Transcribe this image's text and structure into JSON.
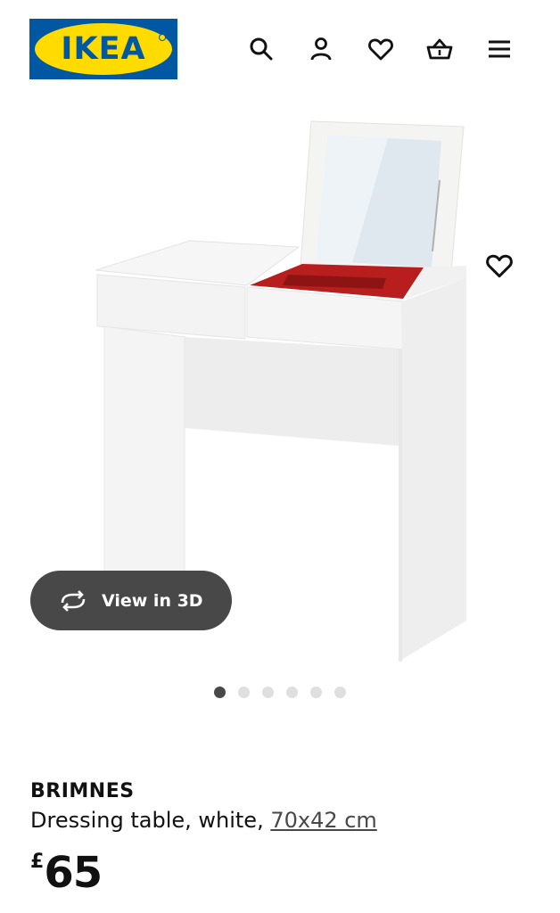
{
  "header": {
    "logo_text": "IKEA",
    "icons": [
      "search-icon",
      "account-icon",
      "favourites-icon",
      "basket-icon",
      "menu-icon"
    ]
  },
  "gallery": {
    "view_3d_label": "View in 3D",
    "slide_count": 6,
    "active_slide": 1
  },
  "product": {
    "name": "BRIMNES",
    "description": "Dressing table, white, ",
    "size_link": "70x42 cm",
    "currency": "£",
    "price": "65"
  },
  "colors": {
    "ikea_blue": "#0058a3",
    "ikea_yellow": "#ffdb00",
    "button_dark": "#484848",
    "drawer_red": "#b81e1e"
  }
}
